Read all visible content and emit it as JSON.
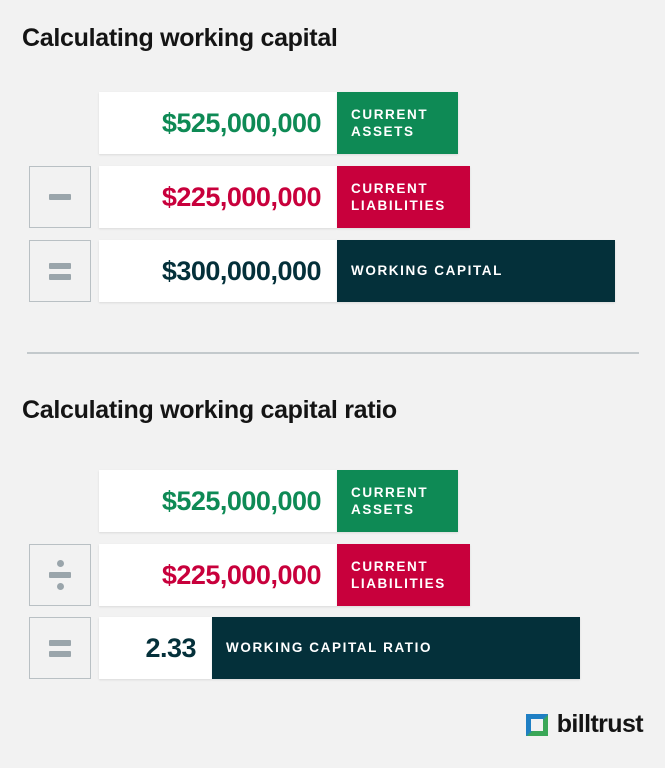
{
  "background_color": "#f2f2f2",
  "colors": {
    "green": "#0e8a55",
    "crimson": "#c8003c",
    "dark_teal": "#04303a",
    "operator_gray": "#9aa5ab",
    "operator_border": "#b9c0c4",
    "divider": "#c3c9cc",
    "text_dark": "#141414",
    "white": "#ffffff",
    "logo_blue": "#1f7fc4",
    "logo_green": "#3aa757"
  },
  "sections": [
    {
      "id": "working-capital",
      "title": "Calculating working capital",
      "rows": [
        {
          "operator": null,
          "operator_name": null,
          "value": "$525,000,000",
          "value_color": "#0e8a55",
          "label": "CURRENT\nASSETS",
          "label_color": "#0e8a55"
        },
        {
          "operator": "−",
          "operator_name": "minus",
          "value": "$225,000,000",
          "value_color": "#c8003c",
          "label": "CURRENT\nLIABILITIES",
          "label_color": "#c8003c"
        },
        {
          "operator": "=",
          "operator_name": "equals",
          "value": "$300,000,000",
          "value_color": "#04303a",
          "label": "WORKING CAPITAL",
          "label_color": "#04303a"
        }
      ]
    },
    {
      "id": "working-capital-ratio",
      "title": "Calculating working capital ratio",
      "rows": [
        {
          "operator": null,
          "operator_name": null,
          "value": "$525,000,000",
          "value_color": "#0e8a55",
          "label": "CURRENT\nASSETS",
          "label_color": "#0e8a55"
        },
        {
          "operator": "÷",
          "operator_name": "divide",
          "value": "$225,000,000",
          "value_color": "#c8003c",
          "label": "CURRENT\nLIABILITIES",
          "label_color": "#c8003c"
        },
        {
          "operator": "=",
          "operator_name": "equals",
          "value": "2.33",
          "value_color": "#04303a",
          "label": "WORKING CAPITAL RATIO",
          "label_color": "#04303a"
        }
      ]
    }
  ],
  "logo": {
    "name": "billtrust-logo",
    "text": "billtrust",
    "mark_name": "billtrust-square-mark"
  }
}
